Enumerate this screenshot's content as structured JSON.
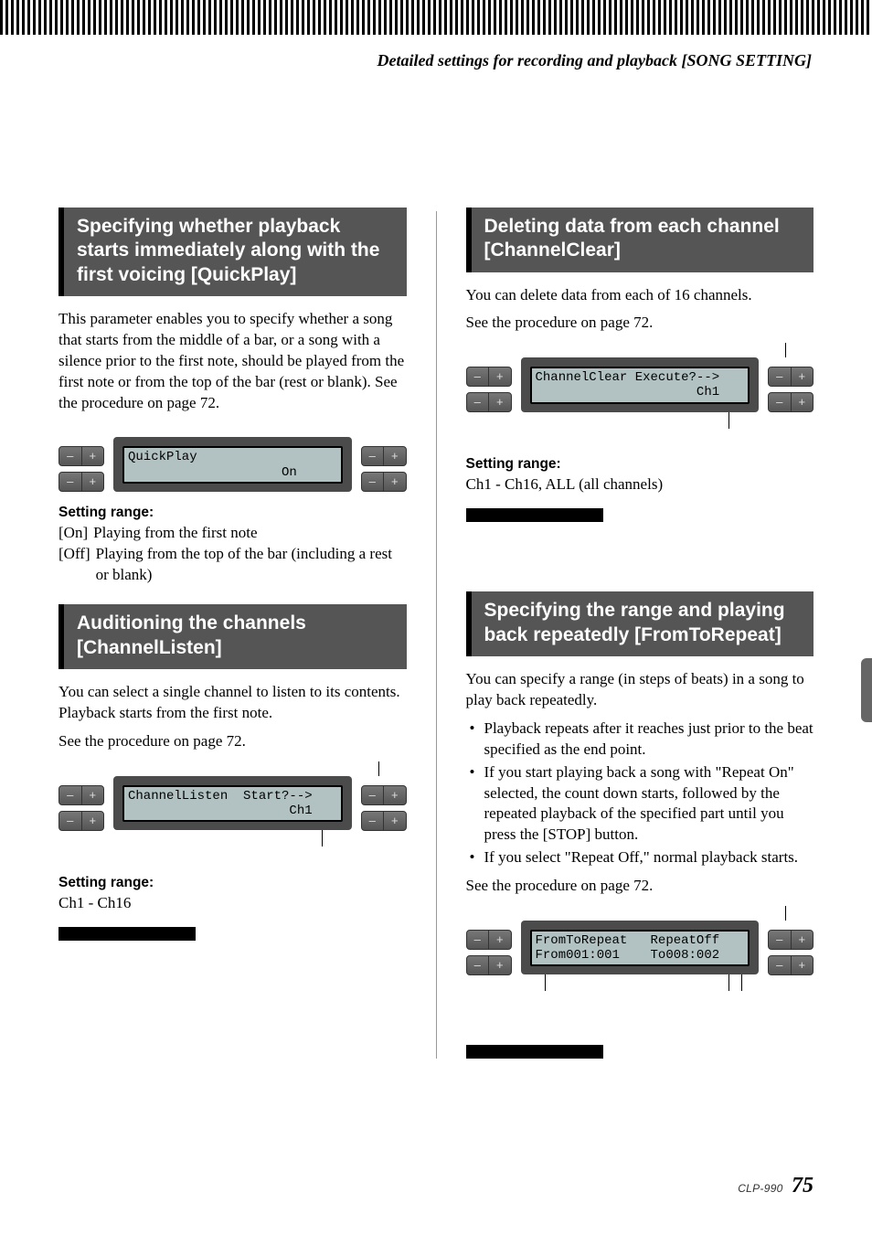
{
  "breadcrumb": "Detailed settings for recording and playback [SONG SETTING]",
  "buttons": {
    "minus": "–",
    "plus": "+"
  },
  "left": {
    "quickplay": {
      "title": "Specifying whether playback starts immediately along with the first voicing [QuickPlay]",
      "p1": "This parameter enables you to specify whether a song that starts from the middle of a bar, or a song with a silence prior to the first note, should be played from the first note or from the top of the bar (rest or blank). See the procedure on page 72.",
      "lcd_line1": "QuickPlay",
      "lcd_line2": "                    On",
      "range_label": "Setting range:",
      "opt_on_tag": "[On]",
      "opt_on_text": "Playing from the first note",
      "opt_off_tag": "[Off]",
      "opt_off_text": "Playing from the top of the bar (including a rest or blank)"
    },
    "channellisten": {
      "title": "Auditioning the channels [ChannelListen]",
      "p1": "You can select a single channel to listen to its contents. Playback starts from the first note.",
      "p2": "See the procedure on page 72.",
      "lcd_line1": "ChannelListen  Start?-->",
      "lcd_line2": "                     Ch1",
      "range_label": "Setting range:",
      "range_value": "Ch1 - Ch16"
    }
  },
  "right": {
    "channelclear": {
      "title": "Deleting data from each channel [ChannelClear]",
      "p1": "You can delete data from each of 16 channels.",
      "p2": "See the procedure on page 72.",
      "lcd_line1": "ChannelClear Execute?-->",
      "lcd_line2": "                     Ch1",
      "range_label": "Setting range:",
      "range_value": "Ch1 - Ch16, ALL (all channels)"
    },
    "fromtorepeat": {
      "title": "Specifying the range and playing back repeatedly [FromToRepeat]",
      "p1": "You can specify a range (in steps of beats) in a song to play back repeatedly.",
      "b1": "Playback repeats after it reaches just prior to the beat specified as the end point.",
      "b2": "If you start playing back a song with \"Repeat On\" selected, the count down starts, followed by the repeated playback of the specified part until you press the [STOP] button.",
      "b3": "If you select \"Repeat Off,\" normal playback starts.",
      "p2": "See the procedure on page 72.",
      "lcd_line1": "FromToRepeat   RepeatOff",
      "lcd_line2": "From001:001    To008:002"
    }
  },
  "footer": {
    "model": "CLP-990",
    "page": "75"
  }
}
